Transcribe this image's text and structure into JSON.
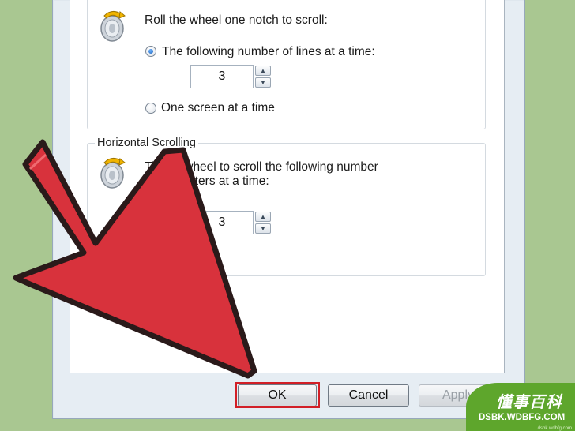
{
  "vertical_scrolling": {
    "instruction": "Roll the wheel one notch to scroll:",
    "option_lines": "The following number of lines at a time:",
    "lines_value": "3",
    "option_screen": "One screen at a time"
  },
  "horizontal_scrolling": {
    "group_title": "Horizontal Scrolling",
    "instruction_line1": "Tilt the wheel to scroll the following number",
    "instruction_line2": "of characters at a time:",
    "chars_value": "3"
  },
  "buttons": {
    "ok": "OK",
    "cancel": "Cancel",
    "apply": "Apply"
  },
  "watermark": {
    "cn": "懂事百科",
    "en": "DSBK.WDBFG.COM",
    "small": "dsbk.wdbfg.com"
  },
  "colors": {
    "background": "#a9c791",
    "highlight": "#d21f26",
    "arrow": "#d8323c",
    "watermark": "#5ea62c"
  },
  "icons": {
    "wheel": "mouse-wheel-icon",
    "arrow": "pointer-arrow"
  }
}
